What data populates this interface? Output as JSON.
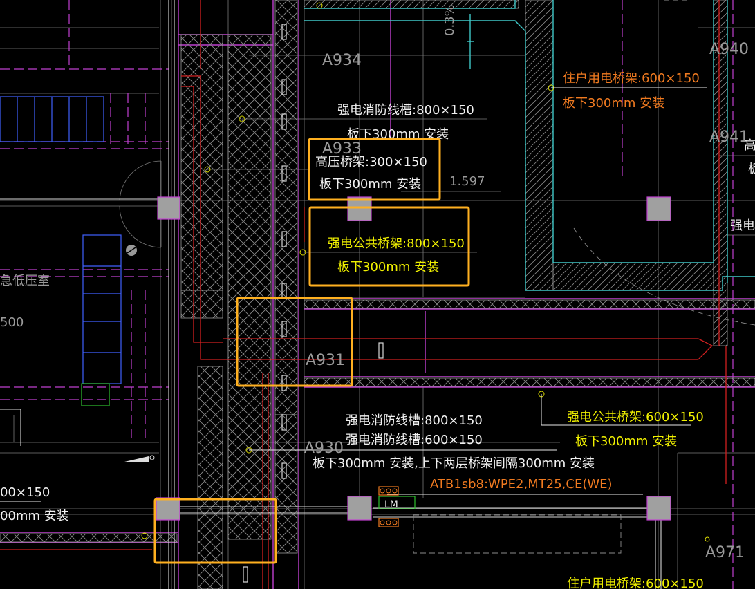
{
  "colors": {
    "background": "#000000",
    "grid": "#8c8c8c",
    "hatch": "#9a9a9a",
    "magenta": "#c040d0",
    "red": "#d02020",
    "cyan": "#40c8c8",
    "blue": "#4060ff",
    "green": "#30c030",
    "white": "#e8e8e8",
    "yellow": "#f0f000",
    "orange_text": "#f07a20",
    "highlight_box": "#ffb020",
    "column": "#a0a0a0"
  },
  "rooms": {
    "a934": "A934",
    "a933": "A933",
    "a931": "A931",
    "a930": "A930",
    "a940": "A940",
    "a941": "A941",
    "a971": "A971",
    "low_voltage_room": "急低压室",
    "left_dim": "500"
  },
  "labels": {
    "fire_tray_1": "强电消防线槽:800×150",
    "fire_tray_1_mount": "板下300mm 安装",
    "hv_tray": "高压桥架:300×150",
    "hv_tray_mount": "板下300mm 安装",
    "dim_1597": "1.597",
    "slope": "0.3%",
    "public_tray_800": "强电公共桥架:800×150",
    "public_tray_800_mount": "板下300mm 安装",
    "resident_tray": "住户用电桥架:600×150",
    "resident_tray_mount": "板下300mm 安装",
    "right_cut_1": "高",
    "right_cut_2": "板",
    "right_cut_3": "强电",
    "public_tray_600": "强电公共桥架:600×150",
    "public_tray_600_mount": "板下300mm 安装",
    "fire_tray_2a": "强电消防线槽:800×150",
    "fire_tray_2b": "强电消防线槽:600×150",
    "fire_tray_2_mount": "板下300mm 安装,上下两层桥架间隔300mm 安装",
    "circuit": "ATB1sb8:WPE2,MT25,CE(WE)",
    "left_tray_size": "00×150",
    "left_tray_mount": "00mm 安装",
    "bottom_cut": "住户用电桥架:600×150",
    "lm_symbol": "LM"
  }
}
